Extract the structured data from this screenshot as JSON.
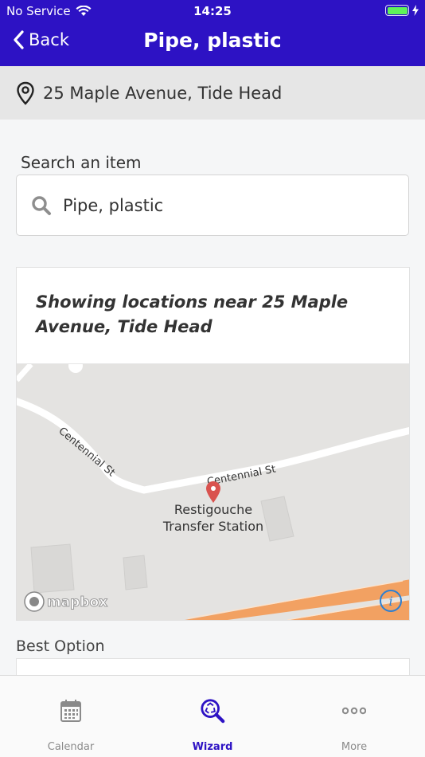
{
  "status_bar": {
    "carrier": "No Service",
    "time": "14:25",
    "battery_level": 1.0,
    "battery_color": "#5ff25a"
  },
  "nav": {
    "back_label": "Back",
    "title": "Pipe, plastic",
    "color": "#2d12c4"
  },
  "address": {
    "icon": "location-pin-icon",
    "text": "25 Maple Avenue, Tide Head"
  },
  "search": {
    "label": "Search an item",
    "value": "Pipe, plastic",
    "icon": "search-icon"
  },
  "locations": {
    "heading": "Showing locations near 25 Maple Avenue, Tide Head",
    "map": {
      "street_labels": [
        "Centennial St",
        "Centennial St"
      ],
      "place_label_line1": "Restigouche",
      "place_label_line2": "Transfer Station",
      "attribution": "mapbox",
      "marker_color": "#d9534f",
      "highway_color": "#f2a162"
    }
  },
  "best_option": {
    "label": "Best Option"
  },
  "tabs": [
    {
      "label": "Calendar",
      "icon": "calendar-icon",
      "active": false
    },
    {
      "label": "Wizard",
      "icon": "recycle-search-icon",
      "active": true
    },
    {
      "label": "More",
      "icon": "more-dots-icon",
      "active": false
    }
  ]
}
